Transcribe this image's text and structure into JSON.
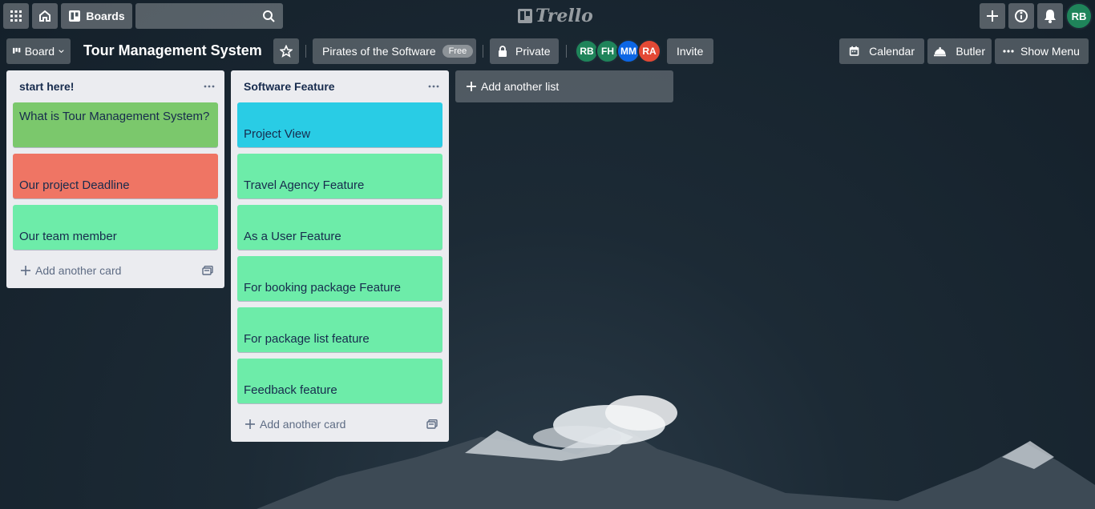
{
  "header": {
    "apps_icon": "grid-icon",
    "home_icon": "home-icon",
    "boards_label": "Boards",
    "search_value": "",
    "logo_text": "Trello",
    "user_initials": "RB"
  },
  "board": {
    "view_label": "Board",
    "title": "Tour Management System",
    "workspace_name": "Pirates of the Software",
    "workspace_badge": "Free",
    "visibility_label": "Private",
    "members": [
      {
        "initials": "RB",
        "color": "#1f845a"
      },
      {
        "initials": "FH",
        "color": "#1f845a"
      },
      {
        "initials": "MM",
        "color": "#0c66e4"
      },
      {
        "initials": "RA",
        "color": "#e34935"
      }
    ],
    "invite_label": "Invite",
    "calendar_label": "Calendar",
    "butler_label": "Butler",
    "show_menu_label": "Show Menu"
  },
  "lists": [
    {
      "title": "start here!",
      "cards": [
        {
          "text": "What is Tour Management System?",
          "color": "#7bc86c"
        },
        {
          "text": "Our project Deadline",
          "color": "#ef7564"
        },
        {
          "text": "Our team member",
          "color": "#6deca9"
        }
      ],
      "add_card_label": "Add another card"
    },
    {
      "title": "Software Feature",
      "cards": [
        {
          "text": "Project View",
          "color": "#29cce5"
        },
        {
          "text": "Travel Agency Feature",
          "color": "#6deca9"
        },
        {
          "text": "As a User Feature",
          "color": "#6deca9"
        },
        {
          "text": "For booking package Feature",
          "color": "#6deca9"
        },
        {
          "text": "For package list feature",
          "color": "#6deca9"
        },
        {
          "text": "Feedback feature",
          "color": "#6deca9"
        }
      ],
      "add_card_label": "Add another card"
    }
  ],
  "add_list_label": "Add another list"
}
